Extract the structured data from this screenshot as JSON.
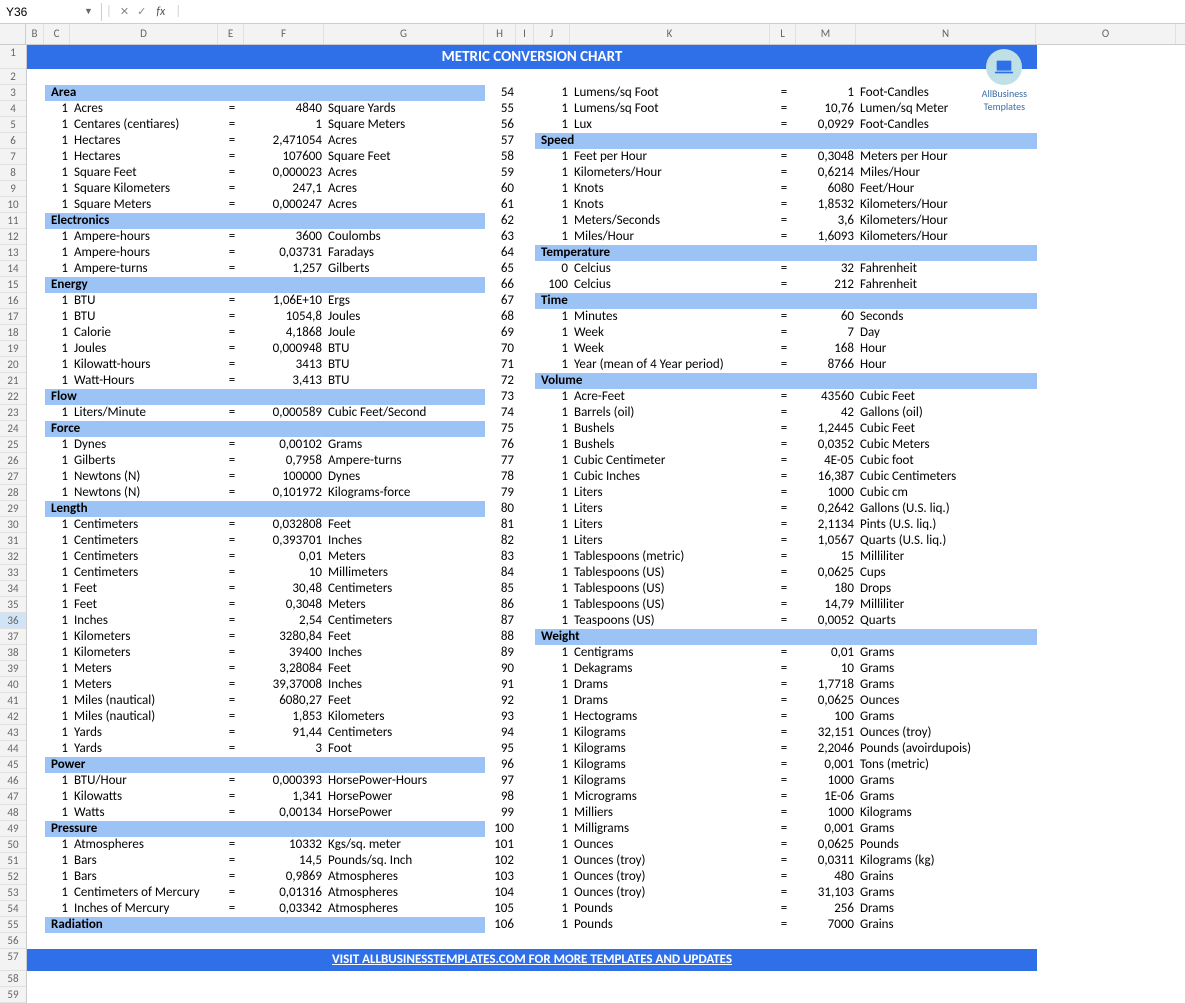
{
  "formula": {
    "cellRef": "Y36",
    "fx": "fx"
  },
  "cols": [
    "B",
    "C",
    "D",
    "E",
    "F",
    "G",
    "H",
    "I",
    "J",
    "K",
    "L",
    "M",
    "N",
    "O"
  ],
  "title": "METRIC CONVERSION CHART",
  "link": "VISIT ALLBUSINESSTEMPLATES.COM FOR MORE TEMPLATES AND UPDATES",
  "logo": "AllBusiness\nTemplates",
  "left": [
    {
      "t": "sec",
      "label": "Area"
    },
    {
      "t": "row",
      "q": "1",
      "from": "Acres",
      "eq": "=",
      "val": "4840",
      "to": "Square Yards"
    },
    {
      "t": "row",
      "q": "1",
      "from": "Centares (centiares)",
      "eq": "=",
      "val": "1",
      "to": "Square Meters"
    },
    {
      "t": "row",
      "q": "1",
      "from": "Hectares",
      "eq": "=",
      "val": "2,471054",
      "to": "Acres"
    },
    {
      "t": "row",
      "q": "1",
      "from": "Hectares",
      "eq": "=",
      "val": "107600",
      "to": "Square Feet"
    },
    {
      "t": "row",
      "q": "1",
      "from": "Square Feet",
      "eq": "=",
      "val": "0,000023",
      "to": "Acres"
    },
    {
      "t": "row",
      "q": "1",
      "from": "Square Kilometers",
      "eq": "=",
      "val": "247,1",
      "to": "Acres"
    },
    {
      "t": "row",
      "q": "1",
      "from": "Square Meters",
      "eq": "=",
      "val": "0,000247",
      "to": "Acres"
    },
    {
      "t": "sec",
      "label": "Electronics"
    },
    {
      "t": "row",
      "q": "1",
      "from": "Ampere-hours",
      "eq": "=",
      "val": "3600",
      "to": "Coulombs"
    },
    {
      "t": "row",
      "q": "1",
      "from": "Ampere-hours",
      "eq": "=",
      "val": "0,03731",
      "to": "Faradays"
    },
    {
      "t": "row",
      "q": "1",
      "from": "Ampere-turns",
      "eq": "=",
      "val": "1,257",
      "to": "Gilberts"
    },
    {
      "t": "sec",
      "label": "Energy"
    },
    {
      "t": "row",
      "q": "1",
      "from": "BTU",
      "eq": "=",
      "val": "1,06E+10",
      "to": "Ergs"
    },
    {
      "t": "row",
      "q": "1",
      "from": "BTU",
      "eq": "=",
      "val": "1054,8",
      "to": "Joules"
    },
    {
      "t": "row",
      "q": "1",
      "from": "Calorie",
      "eq": "=",
      "val": "4,1868",
      "to": "Joule"
    },
    {
      "t": "row",
      "q": "1",
      "from": "Joules",
      "eq": "=",
      "val": "0,000948",
      "to": "BTU"
    },
    {
      "t": "row",
      "q": "1",
      "from": "Kilowatt-hours",
      "eq": "=",
      "val": "3413",
      "to": "BTU"
    },
    {
      "t": "row",
      "q": "1",
      "from": "Watt-Hours",
      "eq": "=",
      "val": "3,413",
      "to": "BTU"
    },
    {
      "t": "sec",
      "label": "Flow"
    },
    {
      "t": "row",
      "q": "1",
      "from": "Liters/Minute",
      "eq": "=",
      "val": "0,000589",
      "to": "Cubic Feet/Second"
    },
    {
      "t": "sec",
      "label": "Force"
    },
    {
      "t": "row",
      "q": "1",
      "from": "Dynes",
      "eq": "=",
      "val": "0,00102",
      "to": "Grams"
    },
    {
      "t": "row",
      "q": "1",
      "from": "Gilberts",
      "eq": "=",
      "val": "0,7958",
      "to": "Ampere-turns"
    },
    {
      "t": "row",
      "q": "1",
      "from": "Newtons (N)",
      "eq": "=",
      "val": "100000",
      "to": "Dynes"
    },
    {
      "t": "row",
      "q": "1",
      "from": "Newtons (N)",
      "eq": "=",
      "val": "0,101972",
      "to": "Kilograms-force"
    },
    {
      "t": "sec",
      "label": "Length"
    },
    {
      "t": "row",
      "q": "1",
      "from": "Centimeters",
      "eq": "=",
      "val": "0,032808",
      "to": "Feet"
    },
    {
      "t": "row",
      "q": "1",
      "from": "Centimeters",
      "eq": "=",
      "val": "0,393701",
      "to": "Inches"
    },
    {
      "t": "row",
      "q": "1",
      "from": "Centimeters",
      "eq": "=",
      "val": "0,01",
      "to": "Meters"
    },
    {
      "t": "row",
      "q": "1",
      "from": "Centimeters",
      "eq": "=",
      "val": "10",
      "to": "Millimeters"
    },
    {
      "t": "row",
      "q": "1",
      "from": "Feet",
      "eq": "=",
      "val": "30,48",
      "to": "Centimeters"
    },
    {
      "t": "row",
      "q": "1",
      "from": "Feet",
      "eq": "=",
      "val": "0,3048",
      "to": "Meters"
    },
    {
      "t": "row",
      "q": "1",
      "from": "Inches",
      "eq": "=",
      "val": "2,54",
      "to": "Centimeters"
    },
    {
      "t": "row",
      "q": "1",
      "from": "Kilometers",
      "eq": "=",
      "val": "3280,84",
      "to": "Feet"
    },
    {
      "t": "row",
      "q": "1",
      "from": "Kilometers",
      "eq": "=",
      "val": "39400",
      "to": "Inches"
    },
    {
      "t": "row",
      "q": "1",
      "from": "Meters",
      "eq": "=",
      "val": "3,28084",
      "to": "Feet"
    },
    {
      "t": "row",
      "q": "1",
      "from": "Meters",
      "eq": "=",
      "val": "39,37008",
      "to": "Inches"
    },
    {
      "t": "row",
      "q": "1",
      "from": "Miles (nautical)",
      "eq": "=",
      "val": "6080,27",
      "to": "Feet"
    },
    {
      "t": "row",
      "q": "1",
      "from": "Miles (nautical)",
      "eq": "=",
      "val": "1,853",
      "to": "Kilometers"
    },
    {
      "t": "row",
      "q": "1",
      "from": "Yards",
      "eq": "=",
      "val": "91,44",
      "to": "Centimeters"
    },
    {
      "t": "row",
      "q": "1",
      "from": "Yards",
      "eq": "=",
      "val": "3",
      "to": "Foot"
    },
    {
      "t": "sec",
      "label": "Power"
    },
    {
      "t": "row",
      "q": "1",
      "from": "BTU/Hour",
      "eq": "=",
      "val": "0,000393",
      "to": "HorsePower-Hours"
    },
    {
      "t": "row",
      "q": "1",
      "from": "Kilowatts",
      "eq": "=",
      "val": "1,341",
      "to": "HorsePower"
    },
    {
      "t": "row",
      "q": "1",
      "from": "Watts",
      "eq": "=",
      "val": "0,00134",
      "to": "HorsePower"
    },
    {
      "t": "sec",
      "label": "Pressure"
    },
    {
      "t": "row",
      "q": "1",
      "from": "Atmospheres",
      "eq": "=",
      "val": "10332",
      "to": "Kgs/sq. meter"
    },
    {
      "t": "row",
      "q": "1",
      "from": "Bars",
      "eq": "=",
      "val": "14,5",
      "to": "Pounds/sq. Inch"
    },
    {
      "t": "row",
      "q": "1",
      "from": "Bars",
      "eq": "=",
      "val": "0,9869",
      "to": "Atmospheres"
    },
    {
      "t": "row",
      "q": "1",
      "from": "Centimeters of Mercury",
      "eq": "=",
      "val": "0,01316",
      "to": "Atmospheres"
    },
    {
      "t": "row",
      "q": "1",
      "from": "Inches of Mercury",
      "eq": "=",
      "val": "0,03342",
      "to": "Atmospheres"
    },
    {
      "t": "sec",
      "label": "Radiation"
    }
  ],
  "right": [
    {
      "t": "row",
      "q": "1",
      "from": "Lumens/sq Foot",
      "eq": "=",
      "val": "1",
      "to": "Foot-Candles"
    },
    {
      "t": "row",
      "q": "1",
      "from": "Lumens/sq Foot",
      "eq": "=",
      "val": "10,76",
      "to": "Lumen/sq Meter"
    },
    {
      "t": "row",
      "q": "1",
      "from": "Lux",
      "eq": "=",
      "val": "0,0929",
      "to": "Foot-Candles"
    },
    {
      "t": "sec",
      "label": "Speed"
    },
    {
      "t": "row",
      "q": "1",
      "from": "Feet per Hour",
      "eq": "=",
      "val": "0,3048",
      "to": "Meters per Hour"
    },
    {
      "t": "row",
      "q": "1",
      "from": "Kilometers/Hour",
      "eq": "=",
      "val": "0,6214",
      "to": "Miles/Hour"
    },
    {
      "t": "row",
      "q": "1",
      "from": "Knots",
      "eq": "=",
      "val": "6080",
      "to": "Feet/Hour"
    },
    {
      "t": "row",
      "q": "1",
      "from": "Knots",
      "eq": "=",
      "val": "1,8532",
      "to": "Kilometers/Hour"
    },
    {
      "t": "row",
      "q": "1",
      "from": "Meters/Seconds",
      "eq": "=",
      "val": "3,6",
      "to": "Kilometers/Hour"
    },
    {
      "t": "row",
      "q": "1",
      "from": "Miles/Hour",
      "eq": "=",
      "val": "1,6093",
      "to": "Kilometers/Hour"
    },
    {
      "t": "sec",
      "label": "Temperature"
    },
    {
      "t": "row",
      "q": "0",
      "from": "Celcius",
      "eq": "=",
      "val": "32",
      "to": "Fahrenheit"
    },
    {
      "t": "row",
      "q": "100",
      "from": "Celcius",
      "eq": "=",
      "val": "212",
      "to": "Fahrenheit"
    },
    {
      "t": "sec",
      "label": "Time"
    },
    {
      "t": "row",
      "q": "1",
      "from": "Minutes",
      "eq": "=",
      "val": "60",
      "to": "Seconds"
    },
    {
      "t": "row",
      "q": "1",
      "from": "Week",
      "eq": "=",
      "val": "7",
      "to": "Day"
    },
    {
      "t": "row",
      "q": "1",
      "from": "Week",
      "eq": "=",
      "val": "168",
      "to": "Hour"
    },
    {
      "t": "row",
      "q": "1",
      "from": "Year (mean of 4 Year period)",
      "eq": "=",
      "val": "8766",
      "to": "Hour"
    },
    {
      "t": "sec",
      "label": "Volume"
    },
    {
      "t": "row",
      "q": "1",
      "from": "Acre-Feet",
      "eq": "=",
      "val": "43560",
      "to": "Cubic Feet"
    },
    {
      "t": "row",
      "q": "1",
      "from": "Barrels (oil)",
      "eq": "=",
      "val": "42",
      "to": "Gallons (oil)"
    },
    {
      "t": "row",
      "q": "1",
      "from": "Bushels",
      "eq": "=",
      "val": "1,2445",
      "to": "Cubic Feet"
    },
    {
      "t": "row",
      "q": "1",
      "from": "Bushels",
      "eq": "=",
      "val": "0,0352",
      "to": "Cubic Meters"
    },
    {
      "t": "row",
      "q": "1",
      "from": "Cubic Centimeter",
      "eq": "=",
      "val": "4E-05",
      "to": "Cubic foot"
    },
    {
      "t": "row",
      "q": "1",
      "from": "Cubic Inches",
      "eq": "=",
      "val": "16,387",
      "to": "Cubic Centimeters"
    },
    {
      "t": "row",
      "q": "1",
      "from": "Liters",
      "eq": "=",
      "val": "1000",
      "to": "Cubic cm"
    },
    {
      "t": "row",
      "q": "1",
      "from": "Liters",
      "eq": "=",
      "val": "0,2642",
      "to": "Gallons (U.S. liq.)"
    },
    {
      "t": "row",
      "q": "1",
      "from": "Liters",
      "eq": "=",
      "val": "2,1134",
      "to": "Pints (U.S. liq.)"
    },
    {
      "t": "row",
      "q": "1",
      "from": "Liters",
      "eq": "=",
      "val": "1,0567",
      "to": "Quarts (U.S. liq.)"
    },
    {
      "t": "row",
      "q": "1",
      "from": "Tablespoons (metric)",
      "eq": "=",
      "val": "15",
      "to": "Milliliter"
    },
    {
      "t": "row",
      "q": "1",
      "from": "Tablespoons (US)",
      "eq": "=",
      "val": "0,0625",
      "to": "Cups"
    },
    {
      "t": "row",
      "q": "1",
      "from": "Tablespoons (US)",
      "eq": "=",
      "val": "180",
      "to": "Drops"
    },
    {
      "t": "row",
      "q": "1",
      "from": "Tablespoons (US)",
      "eq": "=",
      "val": "14,79",
      "to": "Milliliter"
    },
    {
      "t": "row",
      "q": "1",
      "from": "Teaspoons (US)",
      "eq": "=",
      "val": "0,0052",
      "to": "Quarts"
    },
    {
      "t": "sec",
      "label": "Weight"
    },
    {
      "t": "row",
      "q": "1",
      "from": "Centigrams",
      "eq": "=",
      "val": "0,01",
      "to": "Grams"
    },
    {
      "t": "row",
      "q": "1",
      "from": "Dekagrams",
      "eq": "=",
      "val": "10",
      "to": "Grams"
    },
    {
      "t": "row",
      "q": "1",
      "from": "Drams",
      "eq": "=",
      "val": "1,7718",
      "to": "Grams"
    },
    {
      "t": "row",
      "q": "1",
      "from": "Drams",
      "eq": "=",
      "val": "0,0625",
      "to": "Ounces"
    },
    {
      "t": "row",
      "q": "1",
      "from": "Hectograms",
      "eq": "=",
      "val": "100",
      "to": "Grams"
    },
    {
      "t": "row",
      "q": "1",
      "from": "Kilograms",
      "eq": "=",
      "val": "32,151",
      "to": "Ounces (troy)"
    },
    {
      "t": "row",
      "q": "1",
      "from": "Kilograms",
      "eq": "=",
      "val": "2,2046",
      "to": "Pounds (avoirdupois)"
    },
    {
      "t": "row",
      "q": "1",
      "from": "Kilograms",
      "eq": "=",
      "val": "0,001",
      "to": "Tons (metric)"
    },
    {
      "t": "row",
      "q": "1",
      "from": "Kilograms",
      "eq": "=",
      "val": "1000",
      "to": "Grams"
    },
    {
      "t": "row",
      "q": "1",
      "from": "Micrograms",
      "eq": "=",
      "val": "1E-06",
      "to": "Grams"
    },
    {
      "t": "row",
      "q": "1",
      "from": "Milliers",
      "eq": "=",
      "val": "1000",
      "to": "Kilograms"
    },
    {
      "t": "row",
      "q": "1",
      "from": "Milligrams",
      "eq": "=",
      "val": "0,001",
      "to": "Grams"
    },
    {
      "t": "row",
      "q": "1",
      "from": "Ounces",
      "eq": "=",
      "val": "0,0625",
      "to": "Pounds"
    },
    {
      "t": "row",
      "q": "1",
      "from": "Ounces (troy)",
      "eq": "=",
      "val": "0,0311",
      "to": "Kilograms (kg)"
    },
    {
      "t": "row",
      "q": "1",
      "from": "Ounces (troy)",
      "eq": "=",
      "val": "480",
      "to": "Grains"
    },
    {
      "t": "row",
      "q": "1",
      "from": "Ounces (troy)",
      "eq": "=",
      "val": "31,103",
      "to": "Grams"
    },
    {
      "t": "row",
      "q": "1",
      "from": "Pounds",
      "eq": "=",
      "val": "256",
      "to": "Drams"
    },
    {
      "t": "row",
      "q": "1",
      "from": "Pounds",
      "eq": "=",
      "val": "7000",
      "to": "Grains"
    }
  ],
  "rightStartH": 54
}
